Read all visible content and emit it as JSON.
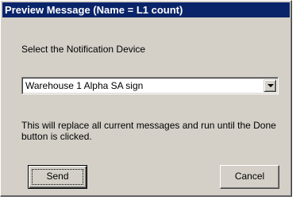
{
  "window": {
    "title": "Preview Message (Name = L1 count)"
  },
  "prompt": {
    "label": "Select the Notification Device"
  },
  "device_select": {
    "selected": "Warehouse 1 Alpha SA sign",
    "icon": "chevron-down-icon"
  },
  "info": {
    "text": "This will replace all current messages and run until the Done button is clicked."
  },
  "buttons": {
    "send_label": "Send",
    "cancel_label": "Cancel"
  },
  "colors": {
    "titlebar": "#0a246a",
    "face": "#d4d0c8"
  }
}
